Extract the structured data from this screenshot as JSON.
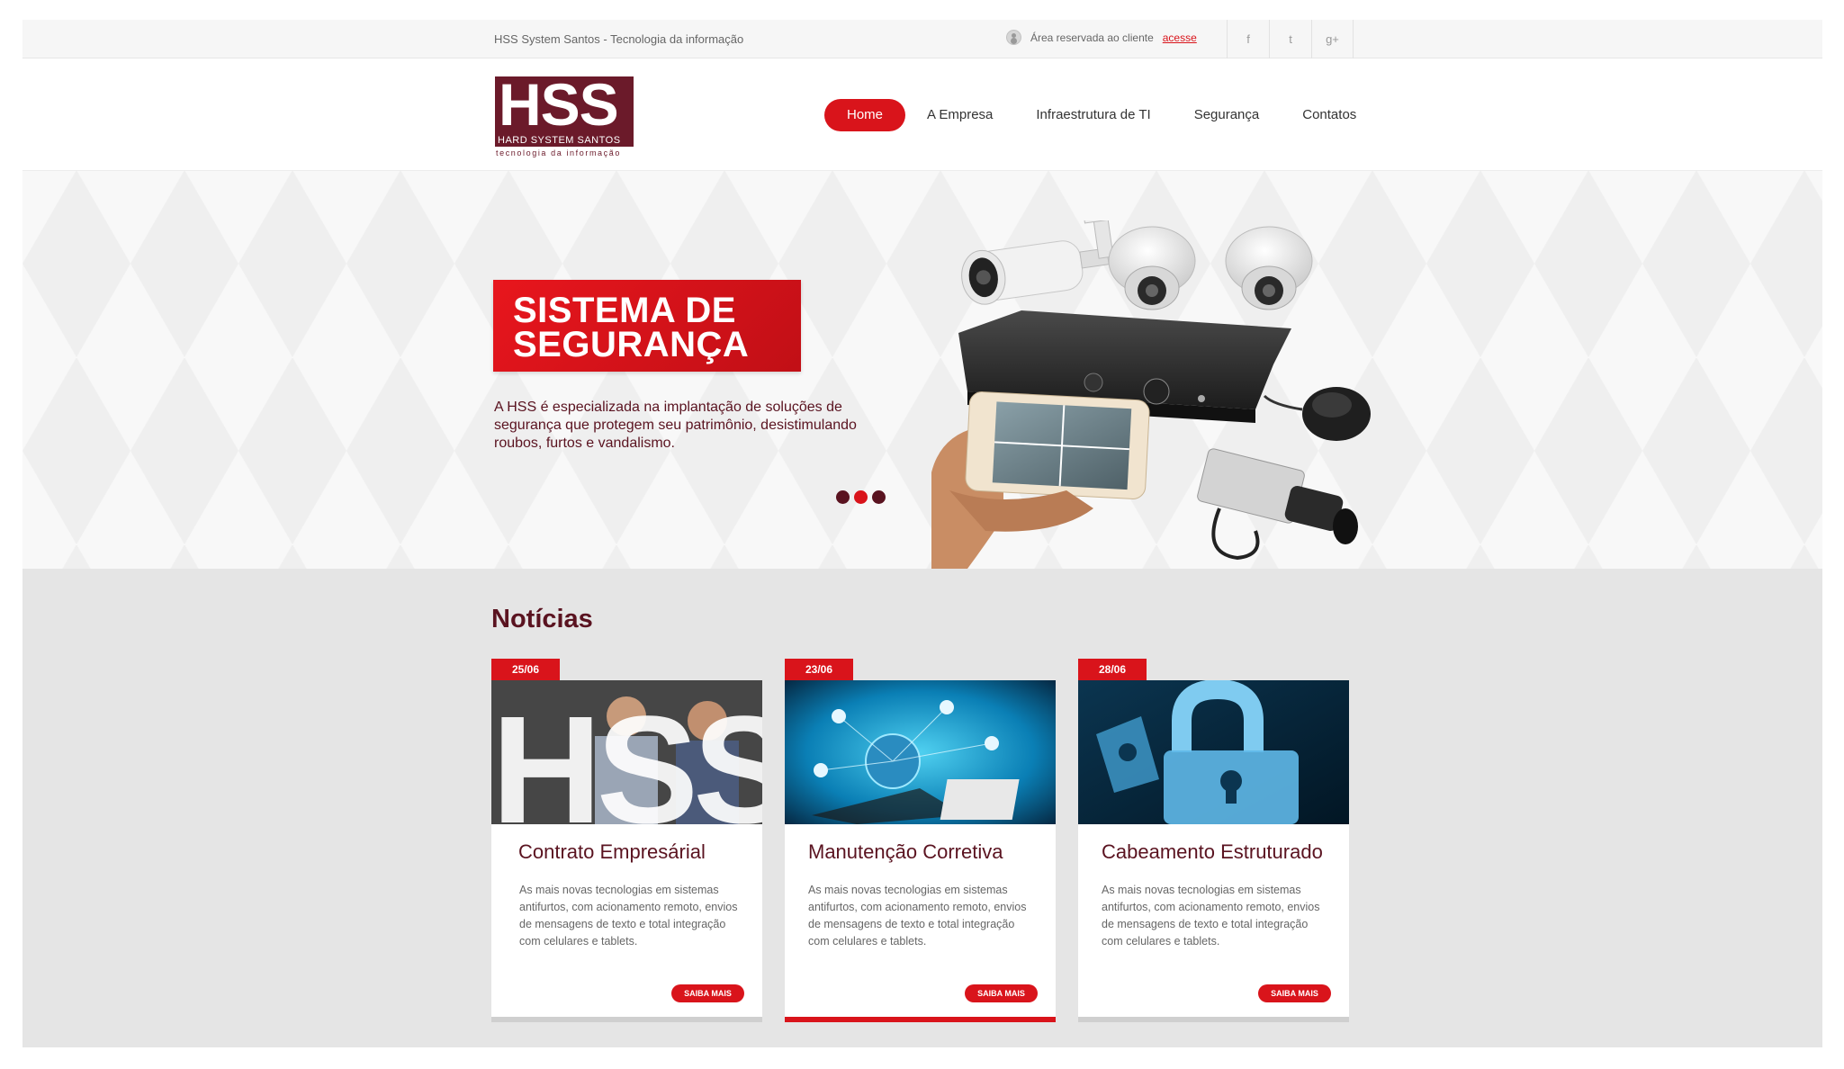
{
  "topbar": {
    "tagline": "HSS System Santos - Tecnologia da informação",
    "client_text": "Área reservada ao cliente",
    "client_link": "acesse",
    "social": [
      "f",
      "t",
      "g+"
    ]
  },
  "logo": {
    "letters": "HSS",
    "band": "HARD SYSTEM SANTOS",
    "sub": "tecnologia da informação"
  },
  "nav": {
    "items": [
      "Home",
      "A Empresa",
      "Infraestrutura de TI",
      "Segurança",
      "Contatos"
    ],
    "active": "Home"
  },
  "hero": {
    "title_line1": "SISTEMA DE",
    "title_line2": "SEGURANÇA",
    "description": "A HSS é especializada na implantação de soluções de segurança que protegem seu patrimônio, desistimulando roubos, furtos e vandalismo.",
    "slides": 3,
    "active_slide": 2
  },
  "news": {
    "title": "Notícias",
    "cards": [
      {
        "date": "25/06",
        "title": "Contrato Empresárial",
        "text": "As mais novas tecnologias em sistemas antifurtos, com acionamento remoto, envios de mensagens de texto e total integração com celulares e tablets.",
        "button": "SAIBA MAIS"
      },
      {
        "date": "23/06",
        "title": "Manutenção Corretiva",
        "text": "As mais novas tecnologias em sistemas antifurtos, com acionamento remoto, envios de mensagens de texto e total integração com celulares e tablets.",
        "button": "SAIBA MAIS"
      },
      {
        "date": "28/06",
        "title": "Cabeamento Estruturado",
        "text": "As mais novas tecnologias em sistemas antifurtos, com acionamento remoto, envios de mensagens de texto e total integração com celulares e tablets.",
        "button": "SAIBA MAIS"
      }
    ]
  },
  "colors": {
    "accent": "#d9141b",
    "brand": "#6b1a2a",
    "text_dark": "#5a1320"
  }
}
